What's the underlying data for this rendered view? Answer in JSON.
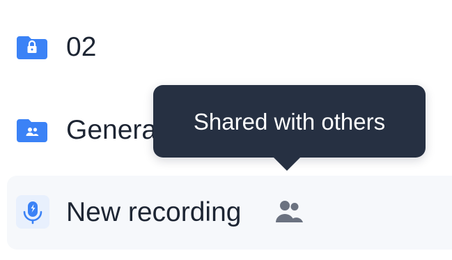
{
  "colors": {
    "folder_blue": "#3b82f6",
    "text": "#1d2533",
    "tooltip_bg": "#263042",
    "tooltip_text": "#ffffff",
    "mic_tile_bg": "#e8f0fd",
    "mic_blue": "#3b82f6",
    "shared_icon": "#6b7280",
    "row_hover_bg": "#f6f8fb"
  },
  "items": [
    {
      "label": "02",
      "icon": "locked-folder-icon"
    },
    {
      "label": "Genera",
      "icon": "shared-folder-icon"
    },
    {
      "label": "New recording",
      "icon": "microphone-icon",
      "badge_icon": "people-icon"
    }
  ],
  "tooltip": {
    "text": "Shared with others"
  }
}
